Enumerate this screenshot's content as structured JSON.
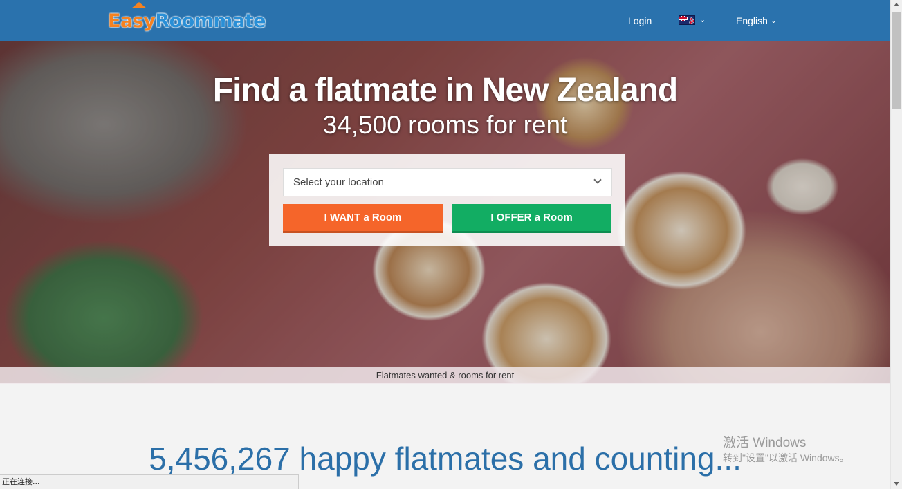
{
  "header": {
    "logo": {
      "part1": "Easy",
      "part2": "Roommate"
    },
    "login_label": "Login",
    "country_flag_icon": "new-zealand-flag",
    "language_label": "English"
  },
  "hero": {
    "title": "Find a flatmate in New Zealand",
    "subtitle": "34,500 rooms for rent",
    "search": {
      "location_placeholder": "Select your location",
      "want_button": "I WANT a Room",
      "offer_button": "I OFFER a Room"
    },
    "caption": "Flatmates wanted & rooms for rent"
  },
  "stats": {
    "counter_text": "5,456,267 happy flatmates and counting..."
  },
  "os_overlay": {
    "watermark_title": "激活 Windows",
    "watermark_sub": "转到\"设置\"以激活 Windows。"
  },
  "browser": {
    "status_text": "正在连接..."
  },
  "colors": {
    "header_bg": "#2a72ad",
    "want_button": "#f5652a",
    "offer_button": "#12ad63",
    "counter_text": "#2b6fa8"
  }
}
